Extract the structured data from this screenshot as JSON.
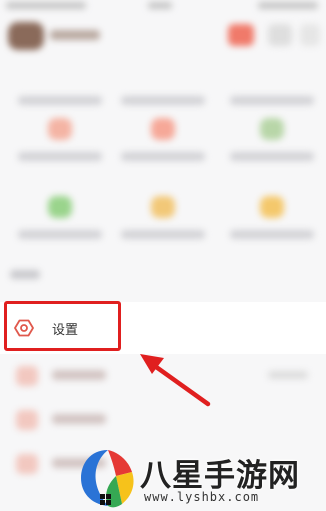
{
  "settings_row": {
    "label": "设置",
    "icon": "settings-hexagon-icon"
  },
  "highlight": {
    "color": "#e01f1f"
  },
  "arrow": {
    "color": "#e01f1f"
  },
  "watermark": {
    "title": "八星手游网",
    "url": "www.lyshbx.com"
  },
  "background_grid_icon_colors": [
    "#f4b4a4",
    "#f6a898",
    "#b8d6a8",
    "#9ad48c",
    "#f2c878",
    "#f4c86c"
  ]
}
